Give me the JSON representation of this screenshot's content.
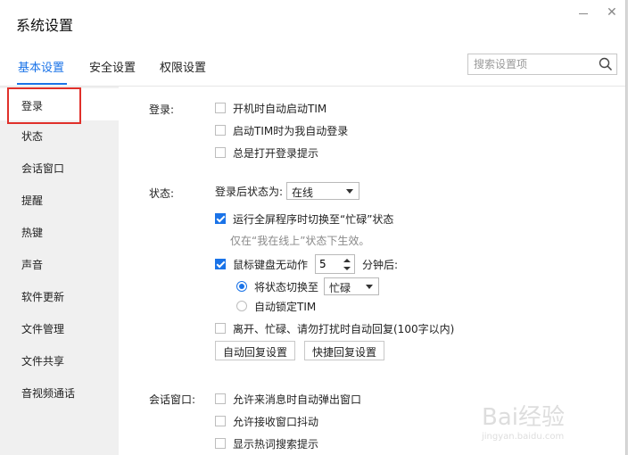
{
  "window": {
    "title": "系统设置"
  },
  "tabs": [
    {
      "label": "基本设置",
      "active": true
    },
    {
      "label": "安全设置",
      "active": false
    },
    {
      "label": "权限设置",
      "active": false
    }
  ],
  "search": {
    "placeholder": "搜索设置项",
    "icon": "search-icon"
  },
  "sidebar": {
    "items": [
      {
        "label": "登录",
        "active": true
      },
      {
        "label": "状态"
      },
      {
        "label": "会话窗口"
      },
      {
        "label": "提醒"
      },
      {
        "label": "热键"
      },
      {
        "label": "声音"
      },
      {
        "label": "软件更新"
      },
      {
        "label": "文件管理"
      },
      {
        "label": "文件共享"
      },
      {
        "label": "音视频通话"
      }
    ]
  },
  "login": {
    "label": "登录:",
    "options": [
      {
        "label": "开机时自动启动TIM",
        "checked": false
      },
      {
        "label": "启动TIM时为我自动登录",
        "checked": false
      },
      {
        "label": "总是打开登录提示",
        "checked": false
      }
    ]
  },
  "status": {
    "label": "状态:",
    "after_login_label": "登录后状态为:",
    "after_login_value": "在线",
    "fullscreen": {
      "label": "运行全屏程序时切换至“忙碌”状态",
      "checked": true
    },
    "fullscreen_hint": "仅在“我在线上”状态下生效。",
    "idle": {
      "label_before": "鼠标键盘无动作",
      "minutes": "5",
      "label_after": "分钟后:",
      "checked": true
    },
    "radio_switch": {
      "label": "将状态切换至",
      "checked": true,
      "value": "忙碌"
    },
    "radio_lock": {
      "label": "自动锁定TIM",
      "checked": false
    },
    "auto_reply": {
      "label": "离开、忙碌、请勿打扰时自动回复(100字以内)",
      "checked": false
    },
    "buttons": {
      "auto_reply_settings": "自动回复设置",
      "quick_reply_settings": "快捷回复设置"
    }
  },
  "session": {
    "label": "会话窗口:",
    "options": [
      {
        "label": "允许来消息时自动弹出窗口",
        "checked": false
      },
      {
        "label": "允许接收窗口抖动",
        "checked": false
      },
      {
        "label": "显示热词搜索提示",
        "checked": false
      }
    ]
  },
  "watermark": {
    "brand": "Bai经验",
    "url": "jingyan.baidu.com"
  },
  "colors": {
    "accent": "#1a73e8",
    "highlight": "#e0302a"
  }
}
